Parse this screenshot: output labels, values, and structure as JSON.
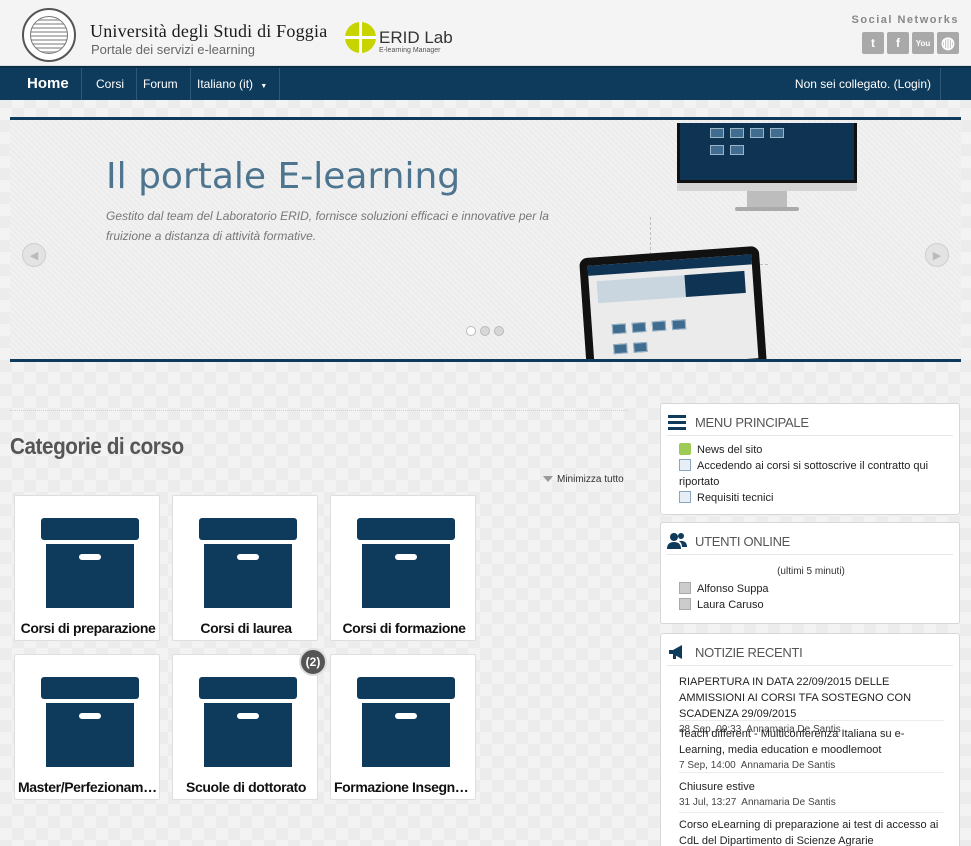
{
  "header": {
    "university_name": "Università degli Studi di Foggia",
    "portal_subtitle": "Portale dei servizi e-learning",
    "erid_title": "ERID Lab",
    "erid_subtitle": "E-learning Manager",
    "social_title": "Social Networks",
    "social_icons": [
      "twitter-icon",
      "facebook-icon",
      "youtube-icon",
      "globe-icon"
    ],
    "social_glyphs": [
      "t",
      "f",
      "You",
      "◍"
    ]
  },
  "nav": {
    "home": "Home",
    "corsi": "Corsi",
    "forum": "Forum",
    "language": "Italiano (it)",
    "login_status": "Non sei collegato. (Login)"
  },
  "slider": {
    "title": "Il portale E-learning",
    "description": "Gestito dal team del Laboratorio ERID, fornisce soluzioni efficaci e innovative per la fruizione a distanza di attività formative.",
    "active_dot": 1,
    "dot_count": 3,
    "prev_glyph": "◀",
    "next_glyph": "▶"
  },
  "categories": {
    "heading": "Categorie di corso",
    "collapse_all": "Minimizza tutto",
    "items": [
      {
        "label": "Corsi di preparazione"
      },
      {
        "label": "Corsi di laurea"
      },
      {
        "label": "Corsi di formazione"
      },
      {
        "label": "Master/Perfezionamen..."
      },
      {
        "label": "Scuole di dottorato",
        "badge": "(2)"
      },
      {
        "label": "Formazione Insegnanti"
      }
    ]
  },
  "sidebar": {
    "menu": {
      "title": "Menu principale",
      "items": [
        {
          "label": "News del sito",
          "icon": "news-icon"
        },
        {
          "label": "Accedendo ai corsi si sottoscrive il contratto qui riportato",
          "icon": "page-icon"
        },
        {
          "label": "Requisiti tecnici",
          "icon": "page-icon"
        }
      ]
    },
    "users": {
      "title": "Utenti online",
      "note": "(ultimi 5 minuti)",
      "list": [
        "Alfonso Suppa",
        "Laura Caruso"
      ]
    },
    "news": {
      "title": "Notizie recenti",
      "items": [
        {
          "title": "RIAPERTURA IN DATA 22/09/2015 DELLE AMMISSIONI AI CORSI TFA SOSTEGNO CON SCADENZA 29/09/2015",
          "date": "28 Sep, 09:33",
          "author": "Annamaria De Santis"
        },
        {
          "title": "Teach different - Multiconferenza Italiana su e-Learning, media education e moodlemoot",
          "date": "7 Sep, 14:00",
          "author": "Annamaria De Santis"
        },
        {
          "title": "Chiusure estive",
          "date": "31 Jul, 13:27",
          "author": "Annamaria De Santis"
        },
        {
          "title": "Corso eLearning di preparazione ai test di accesso ai CdL del Dipartimento di Scienze Agrarie",
          "date": "",
          "author": ""
        }
      ]
    }
  },
  "colors": {
    "navy": "#0e3a5b",
    "accent_green": "#c8d400",
    "slide_title": "#4e7590"
  }
}
